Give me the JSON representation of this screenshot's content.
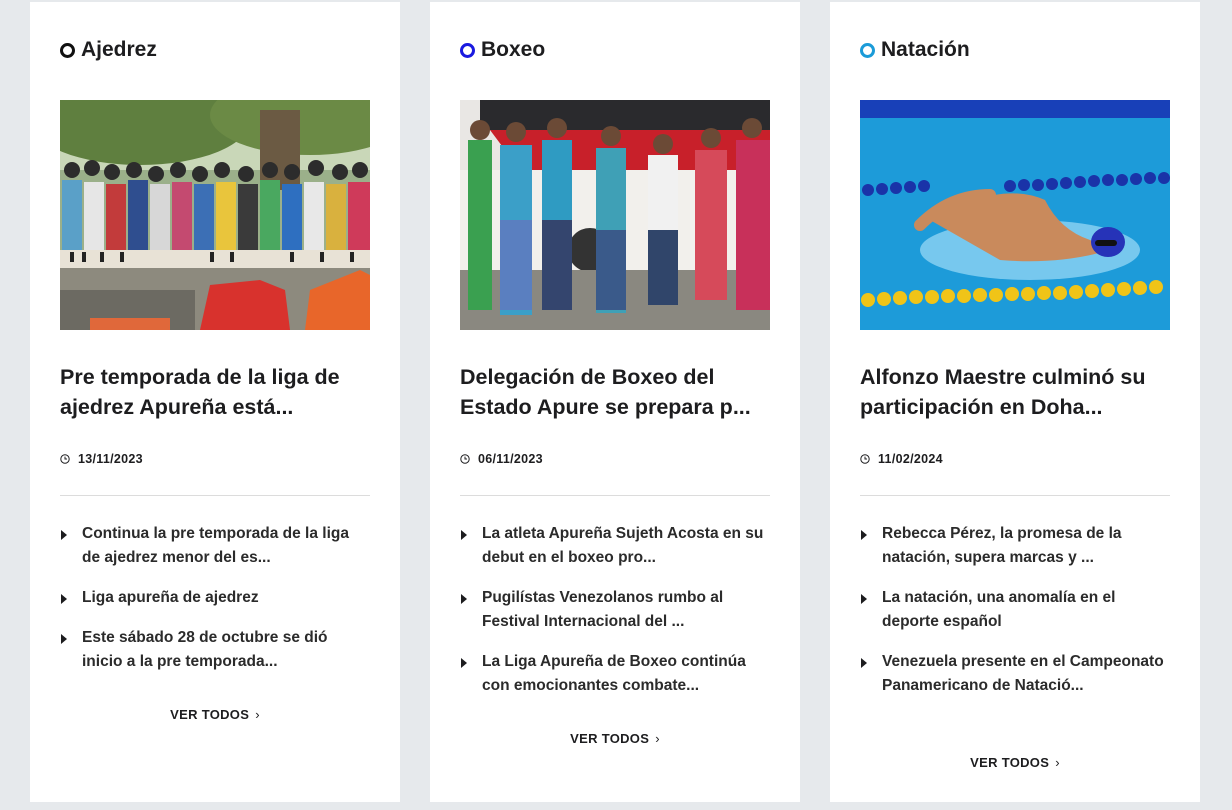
{
  "cards": [
    {
      "category": "Ajedrez",
      "dot_color": "#111111",
      "headline": "Pre temporada de la liga de ajedrez Apureña está...",
      "date": "13/11/2023",
      "items": [
        "Continua la pre temporada de la liga de ajedrez menor del es...",
        "Liga apureña de ajedrez",
        "Este sábado 28 de octubre se dió inicio a la pre temporada..."
      ],
      "more_label": "VER TODOS"
    },
    {
      "category": "Boxeo",
      "dot_color": "#1a1ae0",
      "headline": "Delegación de Boxeo del Estado Apure se prepara p...",
      "date": "06/11/2023",
      "items": [
        "La atleta Apureña Sujeth Acosta en su debut en el boxeo pro...",
        "Pugilístas Venezolanos rumbo al Festival Internacional del ...",
        "La Liga Apureña de Boxeo continúa con emocionantes combate..."
      ],
      "more_label": "VER TODOS"
    },
    {
      "category": "Natación",
      "dot_color": "#1b9bd8",
      "headline": "Alfonzo Maestre culminó su participación en Doha...",
      "date": "11/02/2024",
      "items": [
        "Rebecca Pérez, la promesa de la natación, supera marcas y ...",
        "La natación, una anomalía en el deporte español",
        "Venezuela presente en el Campeonato Panamericano de Natació..."
      ],
      "more_label": "VER TODOS"
    }
  ]
}
